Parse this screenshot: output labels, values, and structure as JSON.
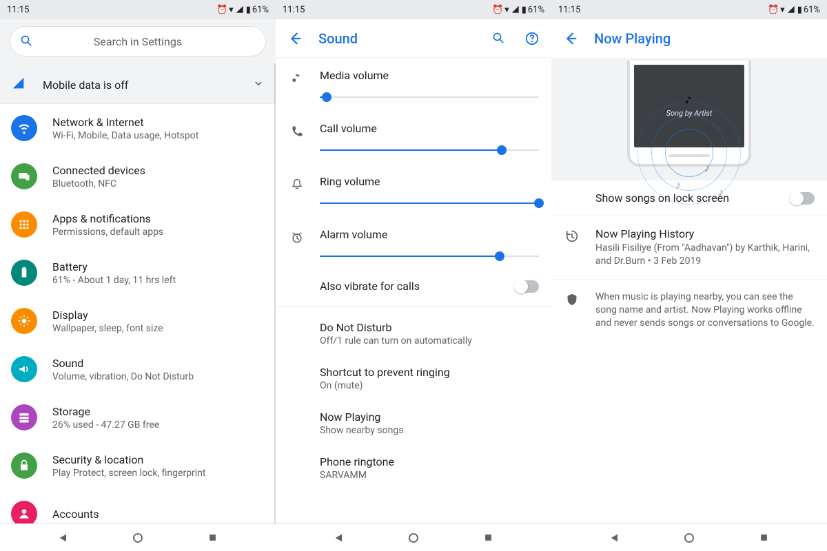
{
  "status": {
    "time": "11:15",
    "battery": "61%"
  },
  "pane1": {
    "search_placeholder": "Search in Settings",
    "banner": {
      "text": "Mobile data is off"
    },
    "items": [
      {
        "title": "Network & Internet",
        "sub": "Wi-Fi, Mobile, Data usage, Hotspot",
        "color": "#1a73e8",
        "icon": "wifi"
      },
      {
        "title": "Connected devices",
        "sub": "Bluetooth, NFC",
        "color": "#43a047",
        "icon": "devices"
      },
      {
        "title": "Apps & notifications",
        "sub": "Permissions, default apps",
        "color": "#fb8c00",
        "icon": "apps"
      },
      {
        "title": "Battery",
        "sub": "61% - About 1 day, 11 hrs left",
        "color": "#00897b",
        "icon": "battery"
      },
      {
        "title": "Display",
        "sub": "Wallpaper, sleep, font size",
        "color": "#fb8c00",
        "icon": "display"
      },
      {
        "title": "Sound",
        "sub": "Volume, vibration, Do Not Disturb",
        "color": "#00acc1",
        "icon": "sound"
      },
      {
        "title": "Storage",
        "sub": "26% used - 47.27 GB free",
        "color": "#ab47bc",
        "icon": "storage"
      },
      {
        "title": "Security & location",
        "sub": "Play Protect, screen lock, fingerprint",
        "color": "#43a047",
        "icon": "security"
      },
      {
        "title": "Accounts",
        "sub": "",
        "color": "#e91e63",
        "icon": "account"
      }
    ]
  },
  "pane2": {
    "title": "Sound",
    "sliders": [
      {
        "label": "Media volume",
        "icon": "music",
        "value": 3
      },
      {
        "label": "Call volume",
        "icon": "phone",
        "value": 83
      },
      {
        "label": "Ring volume",
        "icon": "bell",
        "value": 100
      },
      {
        "label": "Alarm volume",
        "icon": "alarm",
        "value": 82
      }
    ],
    "vibrate": {
      "label": "Also vibrate for calls"
    },
    "rows": [
      {
        "title": "Do Not Disturb",
        "sub": "Off/1 rule can turn on automatically"
      },
      {
        "title": "Shortcut to prevent ringing",
        "sub": "On (mute)"
      },
      {
        "title": "Now Playing",
        "sub": "Show nearby songs"
      },
      {
        "title": "Phone ringtone",
        "sub": "SARVAMM"
      }
    ]
  },
  "pane3": {
    "title": "Now Playing",
    "hero_caption": "Song by Artist",
    "show_lock": {
      "label": "Show songs on lock screen"
    },
    "history": {
      "title": "Now Playing History",
      "sub": "Hasili Fisiliye (From \"Aadhavan\") by Karthik, Harini, and Dr.Burn • 3 Feb 2019"
    },
    "info": "When music is playing nearby, you can see the song name and artist. Now Playing works offline and never sends songs or conversations to Google."
  }
}
